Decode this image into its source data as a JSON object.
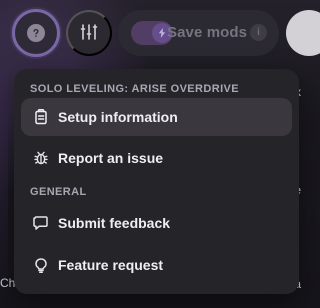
{
  "topbar": {
    "help_icon": "question-mark-icon",
    "settings_icon": "sliders-icon",
    "save_mods_label": "Save mods",
    "save_mods_info_icon": "info-icon",
    "save_mods_toggle_icon": "lightning-icon",
    "save_mods_enabled": true
  },
  "background": {
    "bottom_left_text": "Ch",
    "right_marks": [
      "x",
      "e",
      "a"
    ]
  },
  "menu": {
    "section_solo_leveling": "SOLO LEVELING: ARISE OVERDRIVE",
    "section_general": "GENERAL",
    "items": [
      {
        "label": "Setup information",
        "icon": "clipboard-icon",
        "active": true
      },
      {
        "label": "Report an issue",
        "icon": "bug-icon",
        "active": false
      },
      {
        "label": "Submit feedback",
        "icon": "message-square-icon",
        "active": false
      },
      {
        "label": "Feature request",
        "icon": "lightbulb-icon",
        "active": false
      }
    ]
  },
  "colors": {
    "accent": "#7b67a6",
    "menu_bg": "#252429",
    "active_item_bg": "#3a383e",
    "text_primary": "#f0eef4",
    "text_secondary": "#aaa6b2"
  }
}
